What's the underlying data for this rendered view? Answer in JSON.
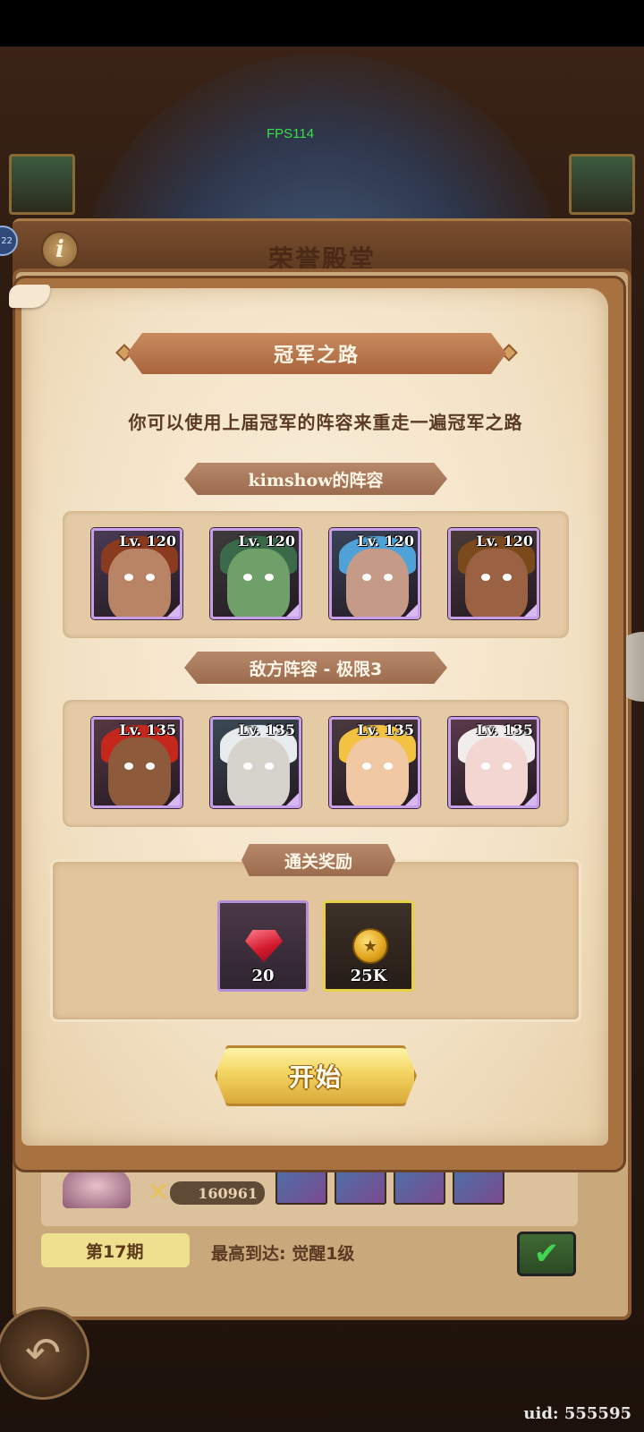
{
  "hud": {
    "fps": "FPS114",
    "uid": "uid: 555595",
    "badge_left": "22"
  },
  "hall": {
    "title": "荣誉殿堂",
    "info_glyph": "i"
  },
  "under": {
    "score": "160961",
    "season": "第17期",
    "max_reach": "最高到达: 觉醒1级"
  },
  "modal": {
    "title": "冠军之路",
    "subtitle": "你可以使用上届冠军的阵容来重走一遍冠军之路",
    "player_team_label": "kimshow的阵容",
    "enemy_team_label": "敌方阵容 - 极限3",
    "reward_label": "通关奖励",
    "start_label": "开始"
  },
  "player_team": [
    {
      "level": "Lv. 120",
      "bg": "#4a3a55",
      "skin": "#b98465",
      "hair": "#8a3a1e"
    },
    {
      "level": "Lv. 120",
      "bg": "#3c3b3a",
      "skin": "#6fa06a",
      "hair": "#3a6a4a"
    },
    {
      "level": "Lv. 120",
      "bg": "#3a4358",
      "skin": "#c59a86",
      "hair": "#4fa2d8"
    },
    {
      "level": "Lv. 120",
      "bg": "#4a3a3a",
      "skin": "#9a6243",
      "hair": "#7a4a1c"
    }
  ],
  "enemy_team": [
    {
      "level": "Lv. 135",
      "bg": "#553842",
      "skin": "#8e5a3c",
      "hair": "#c5271d"
    },
    {
      "level": "Lv. 135",
      "bg": "#3a4a55",
      "skin": "#d6d2cc",
      "hair": "#e8ecef"
    },
    {
      "level": "Lv. 135",
      "bg": "#4a3a3f",
      "skin": "#f0c8a4",
      "hair": "#f3c240"
    },
    {
      "level": "Lv. 135",
      "bg": "#5a3a4a",
      "skin": "#f3d6d2",
      "hair": "#f1eded"
    }
  ],
  "rewards": [
    {
      "icon": "ruby-gem-icon",
      "qty": "20"
    },
    {
      "icon": "gold-coin-icon",
      "qty": "25K"
    }
  ]
}
